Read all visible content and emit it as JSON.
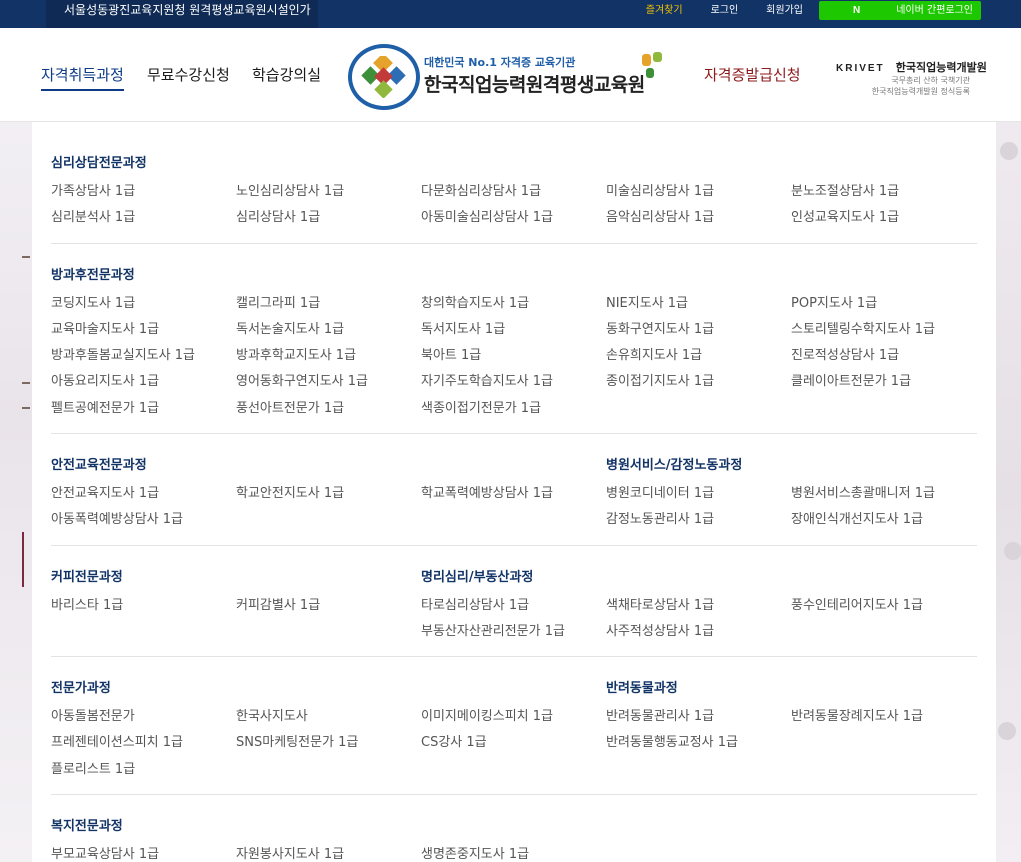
{
  "topbar": {
    "notice": "서울성동광진교육지원청 원격평생교육원시설인가",
    "favorites": "즐겨찾기",
    "login": "로그인",
    "signup": "회원가입",
    "naver_login": "네이버 간편로그인",
    "naver_n": "N"
  },
  "nav": {
    "courses": "자격취득과정",
    "free": "무료수강신청",
    "classroom": "학습강의실",
    "certificate": "자격증발급신청"
  },
  "logo": {
    "tagline": "대한민국 No.1 자격증 교육기관",
    "title": "한국직업능력원격평생교육원"
  },
  "krivet": {
    "brand": "KRIVET",
    "brand_kr": "한국직업능력개발원",
    "sub1": "국무총리 산하 국책기관",
    "sub2": "한국직업능력개발원 정식등록"
  },
  "colors": {
    "topbar": "#123366",
    "accent": "#0d3b86",
    "section_title": "#123366",
    "naver": "#1ec800",
    "certificate": "#8c1a1a"
  },
  "menu": {
    "psych": {
      "title": "심리상담전문과정",
      "items": [
        "가족상담사 1급",
        "노인심리상담사 1급",
        "다문화심리상담사 1급",
        "미술심리상담사 1급",
        "분노조절상담사 1급",
        "심리분석사 1급",
        "심리상담사 1급",
        "아동미술심리상담사 1급",
        "음악심리상담사 1급",
        "인성교육지도사 1급"
      ]
    },
    "afterschool": {
      "title": "방과후전문과정",
      "items": [
        "코딩지도사 1급",
        "캘리그라피 1급",
        "창의학습지도사 1급",
        "NIE지도사 1급",
        "POP지도사 1급",
        "교육마술지도사 1급",
        "독서논술지도사 1급",
        "독서지도사 1급",
        "동화구연지도사 1급",
        "스토리텔링수학지도사 1급",
        "방과후돌봄교실지도사 1급",
        "방과후학교지도사 1급",
        "북아트 1급",
        "손유희지도사 1급",
        "진로적성상담사 1급",
        "아동요리지도사 1급",
        "영어동화구연지도사 1급",
        "자기주도학습지도사 1급",
        "종이접기지도사 1급",
        "클레이아트전문가 1급",
        "펠트공예전문가 1급",
        "풍선아트전문가 1급",
        "색종이접기전문가 1급"
      ]
    },
    "safety": {
      "title": "안전교육전문과정",
      "items": [
        "안전교육지도사 1급",
        "학교안전지도사 1급",
        "학교폭력예방상담사 1급",
        "아동폭력예방상담사 1급"
      ]
    },
    "hospital": {
      "title": "병원서비스/감정노동과정",
      "items": [
        "병원코디네이터 1급",
        "병원서비스총괄매니저 1급",
        "감정노동관리사 1급",
        "장애인식개선지도사 1급"
      ]
    },
    "coffee": {
      "title": "커피전문과정",
      "items": [
        "바리스타 1급",
        "커피감별사 1급"
      ]
    },
    "fortune": {
      "title": "명리심리/부동산과정",
      "items": [
        "타로심리상담사 1급",
        "색채타로상담사 1급",
        "풍수인테리어지도사 1급",
        "부동산자산관리전문가 1급",
        "사주적성상담사 1급"
      ]
    },
    "expert": {
      "title": "전문가과정",
      "items": [
        "아동돌봄전문가",
        "한국사지도사",
        "이미지메이킹스피치 1급",
        "프레젠테이션스피치 1급",
        "SNS마케팅전문가 1급",
        "CS강사 1급",
        "플로리스트 1급"
      ]
    },
    "pet": {
      "title": "반려동물과정",
      "items": [
        "반려동물관리사 1급",
        "반려동물장례지도사 1급",
        "반려동물행동교정사 1급"
      ]
    },
    "welfare": {
      "title": "복지전문과정",
      "items": [
        "부모교육상담사 1급",
        "자원봉사지도사 1급",
        "생명존중지도사 1급"
      ]
    }
  }
}
